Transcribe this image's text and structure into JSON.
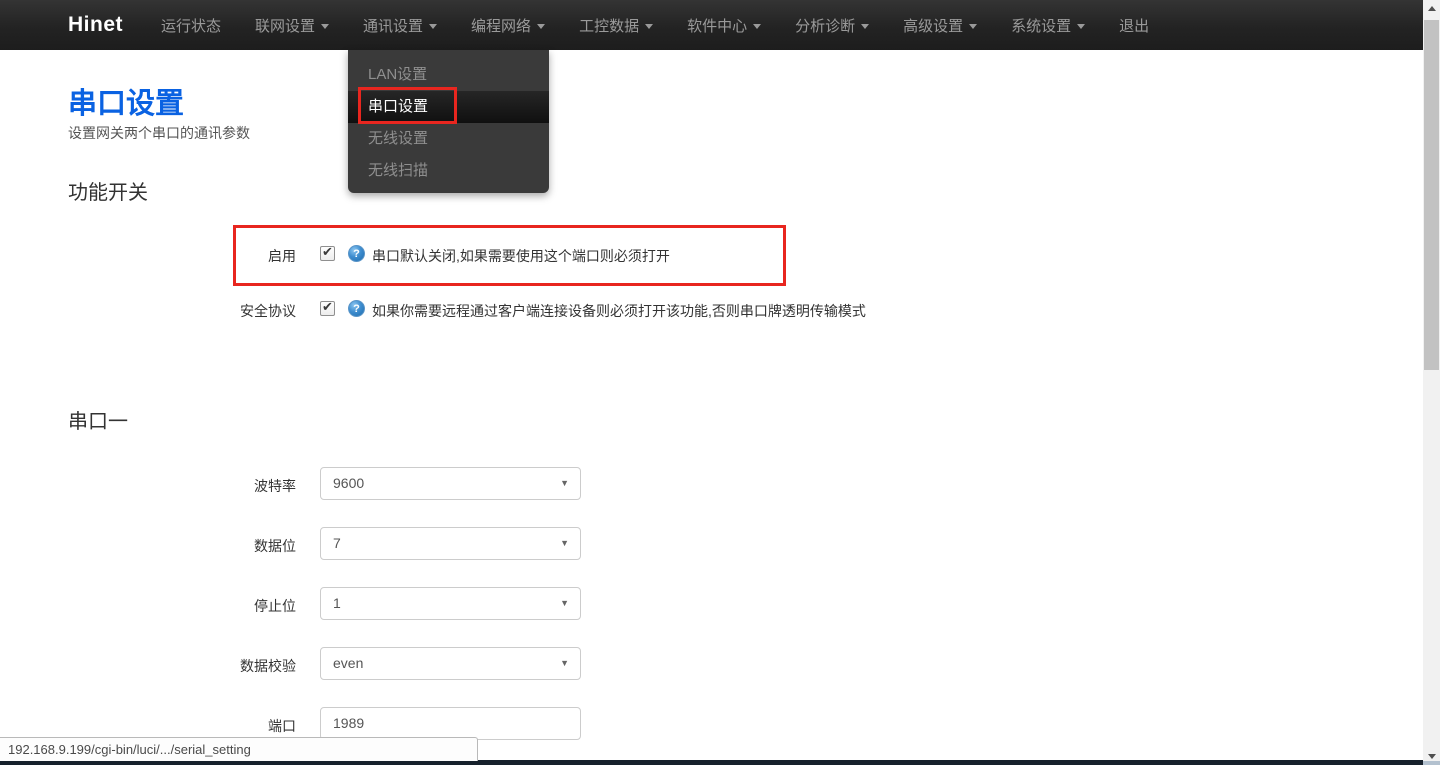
{
  "navbar": {
    "brand": "Hinet",
    "items": [
      {
        "label": "运行状态",
        "caret": false
      },
      {
        "label": "联网设置",
        "caret": true
      },
      {
        "label": "通讯设置",
        "caret": true
      },
      {
        "label": "编程网络",
        "caret": true
      },
      {
        "label": "工控数据",
        "caret": true
      },
      {
        "label": "软件中心",
        "caret": true
      },
      {
        "label": "分析诊断",
        "caret": true
      },
      {
        "label": "高级设置",
        "caret": true
      },
      {
        "label": "系统设置",
        "caret": true
      },
      {
        "label": "退出",
        "caret": false
      }
    ]
  },
  "dropdown": {
    "parent": "通讯设置",
    "items": [
      {
        "label": "LAN设置",
        "active": false
      },
      {
        "label": "串口设置",
        "active": true,
        "annotated": true
      },
      {
        "label": "无线设置",
        "active": false
      },
      {
        "label": "无线扫描",
        "active": false
      }
    ]
  },
  "page": {
    "title": "串口设置",
    "subtitle": "设置网关两个串口的通讯参数"
  },
  "function_switch_section": {
    "heading": "功能开关",
    "rows": [
      {
        "label": "启用",
        "checked": true,
        "help_text": "串口默认关闭,如果需要使用这个端口则必须打开",
        "annotated": true
      },
      {
        "label": "安全协议",
        "checked": true,
        "help_text": "如果你需要远程通过客户端连接设备则必须打开该功能,否则串口牌透明传输模式",
        "annotated": false
      }
    ]
  },
  "serial_port_section": {
    "heading": "串口一",
    "fields": [
      {
        "label": "波特率",
        "value": "9600",
        "type": "select"
      },
      {
        "label": "数据位",
        "value": "7",
        "type": "select"
      },
      {
        "label": "停止位",
        "value": "1",
        "type": "select"
      },
      {
        "label": "数据校验",
        "value": "even",
        "type": "select"
      },
      {
        "label": "端口",
        "value": "1989",
        "type": "text"
      }
    ]
  },
  "statusbar": {
    "url": "192.168.9.199/cgi-bin/luci/.../serial_setting"
  },
  "colors": {
    "accent_blue": "#0a62e2",
    "annotation_red": "#e8261f",
    "navbar_bg": "#232323",
    "active_item_bg": "#151515"
  }
}
